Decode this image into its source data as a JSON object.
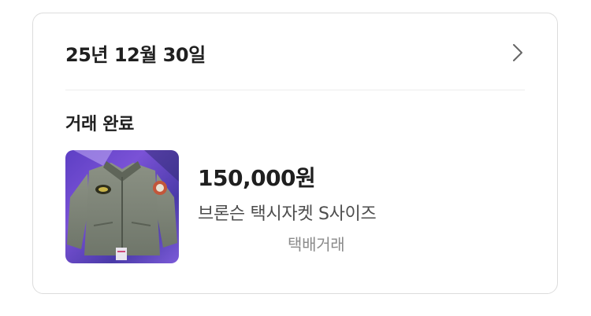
{
  "transaction": {
    "date": "25년 12월 30일",
    "status": "거래 완료",
    "item": {
      "price": "150,000원",
      "title": "브론슨 택시자켓 S사이즈",
      "delivery_method": "택배거래",
      "thumbnail_icon": "jacket-photo"
    }
  },
  "colors": {
    "text_primary": "#1f1f1f",
    "text_secondary": "#4d4d4d",
    "text_muted": "#8a8a8a",
    "border": "#dcdcdc",
    "chevron": "#666666"
  }
}
